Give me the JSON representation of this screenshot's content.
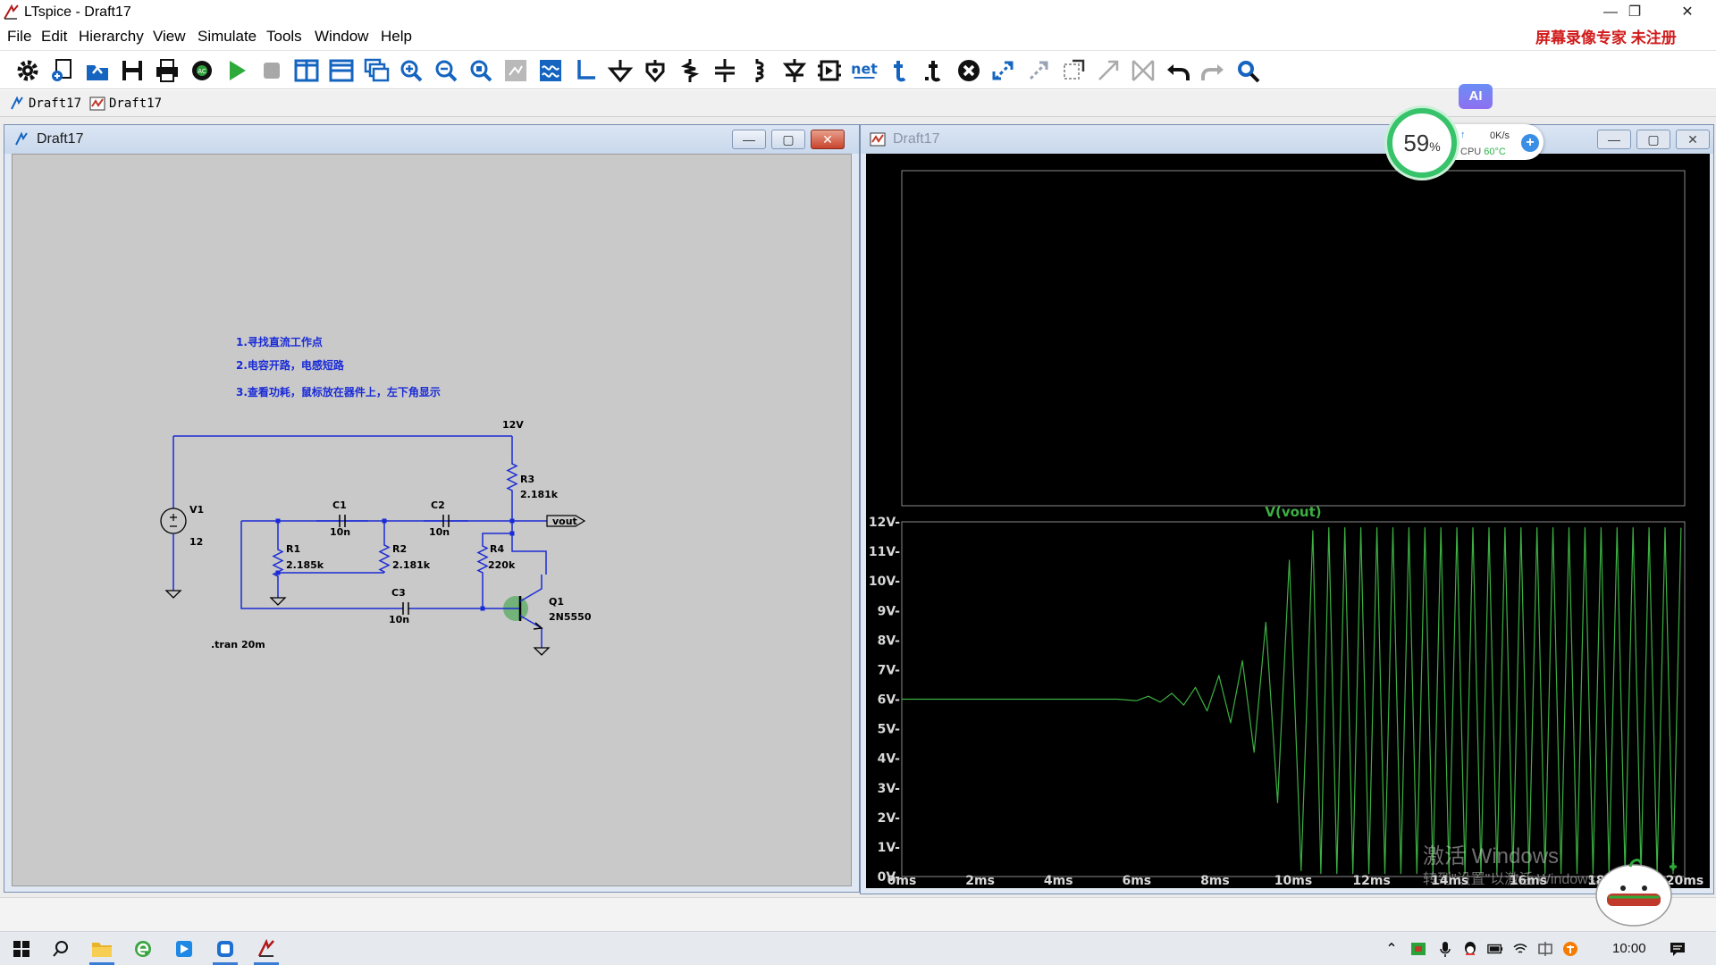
{
  "window": {
    "title": "LTspice - Draft17",
    "watermark": "屏幕录像专家  未注册"
  },
  "menu": [
    "File",
    "Edit",
    "Hierarchy",
    "View",
    "Simulate",
    "Tools",
    "Window",
    "Help"
  ],
  "toolbar_icons": [
    "settings-icon",
    "new-schematic-icon",
    "open-icon",
    "save-icon",
    "print-icon",
    "control-panel-icon",
    "run-icon",
    "halt-icon",
    "tile-vertical-icon",
    "tile-horizontal-icon",
    "cascade-icon",
    "zoom-in-icon",
    "zoom-out-icon",
    "zoom-fit-icon",
    "autorange-icon",
    "waveform-icon",
    "wire-icon",
    "ground-icon",
    "label-net-icon",
    "resistor-icon",
    "capacitor-icon",
    "inductor-icon",
    "diode-icon",
    "component-icon",
    "net-icon",
    "text-icon",
    "spice-directive-icon",
    "delete-icon",
    "move-icon",
    "drag-icon",
    "rotate-icon",
    "mirror-icon",
    "bus-tap-icon",
    "undo-icon",
    "redo-icon",
    "find-icon"
  ],
  "toolbar_net_label": "net",
  "tabs": [
    {
      "label": "Draft17"
    },
    {
      "label": "Draft17"
    }
  ],
  "schematic_window": {
    "title": "Draft17"
  },
  "waveform_window": {
    "title": "Draft17"
  },
  "schematic": {
    "notes": [
      "1.寻找直流工作点",
      "2.电容开路，电感短路",
      "3.查看功耗，鼠标放在器件上，左下角显示"
    ],
    "supply_label": "12V",
    "v1": {
      "name": "V1",
      "value": "12"
    },
    "r1": {
      "name": "R1",
      "value": "2.185k"
    },
    "r2": {
      "name": "R2",
      "value": "2.181k"
    },
    "r3": {
      "name": "R3",
      "value": "2.181k"
    },
    "r4": {
      "name": "R4",
      "value": "220k"
    },
    "c1": {
      "name": "C1",
      "value": "10n"
    },
    "c2": {
      "name": "C2",
      "value": "10n"
    },
    "c3": {
      "name": "C3",
      "value": "10n"
    },
    "q1": {
      "name": "Q1",
      "value": "2N5550"
    },
    "net_label": "vout",
    "directive": ".tran 20m"
  },
  "chart_data": {
    "type": "line",
    "title": "V(vout)",
    "xlabel": "",
    "ylabel": "",
    "xlim": [
      0,
      20
    ],
    "ylim": [
      0,
      12
    ],
    "x_ticks": [
      "0ms",
      "2ms",
      "4ms",
      "6ms",
      "8ms",
      "10ms",
      "12ms",
      "14ms",
      "16ms",
      "18ms",
      "20ms"
    ],
    "y_ticks": [
      "0V-",
      "1V-",
      "2V-",
      "3V-",
      "4V-",
      "5V-",
      "6V-",
      "7V-",
      "8V-",
      "9V-",
      "10V-",
      "11V-",
      "12V-"
    ],
    "grid": false,
    "color": "#3cb043",
    "series": [
      {
        "name": "V(vout)",
        "description_points": [
          [
            0,
            6.0
          ],
          [
            5.5,
            6.0
          ],
          [
            6.0,
            5.95
          ],
          [
            6.3,
            6.1
          ],
          [
            6.6,
            5.9
          ],
          [
            6.9,
            6.2
          ],
          [
            7.2,
            5.8
          ],
          [
            7.5,
            6.4
          ],
          [
            7.8,
            5.6
          ],
          [
            8.1,
            6.8
          ],
          [
            8.4,
            5.2
          ],
          [
            8.7,
            7.3
          ],
          [
            9.0,
            4.2
          ],
          [
            9.3,
            8.6
          ],
          [
            9.6,
            2.5
          ],
          [
            9.9,
            10.7
          ],
          [
            10.2,
            0.2
          ],
          [
            10.5,
            11.7
          ]
        ],
        "steady_period_ms": 0.409,
        "steady_min_v": 0.1,
        "steady_max_v": 11.8,
        "steady_start_ms": 9.2
      }
    ]
  },
  "perf_widget": {
    "percent": "59",
    "percent_unit": "%",
    "net_speed": "0K/s",
    "cpu_label": "CPU",
    "cpu_temp": "60°C"
  },
  "ai_badge": "AI",
  "windows_watermark": {
    "line1": "激活 Windows",
    "line2": "转到\"设置\"以激活 Windows。"
  },
  "taskbar": {
    "clock": "10:00"
  }
}
